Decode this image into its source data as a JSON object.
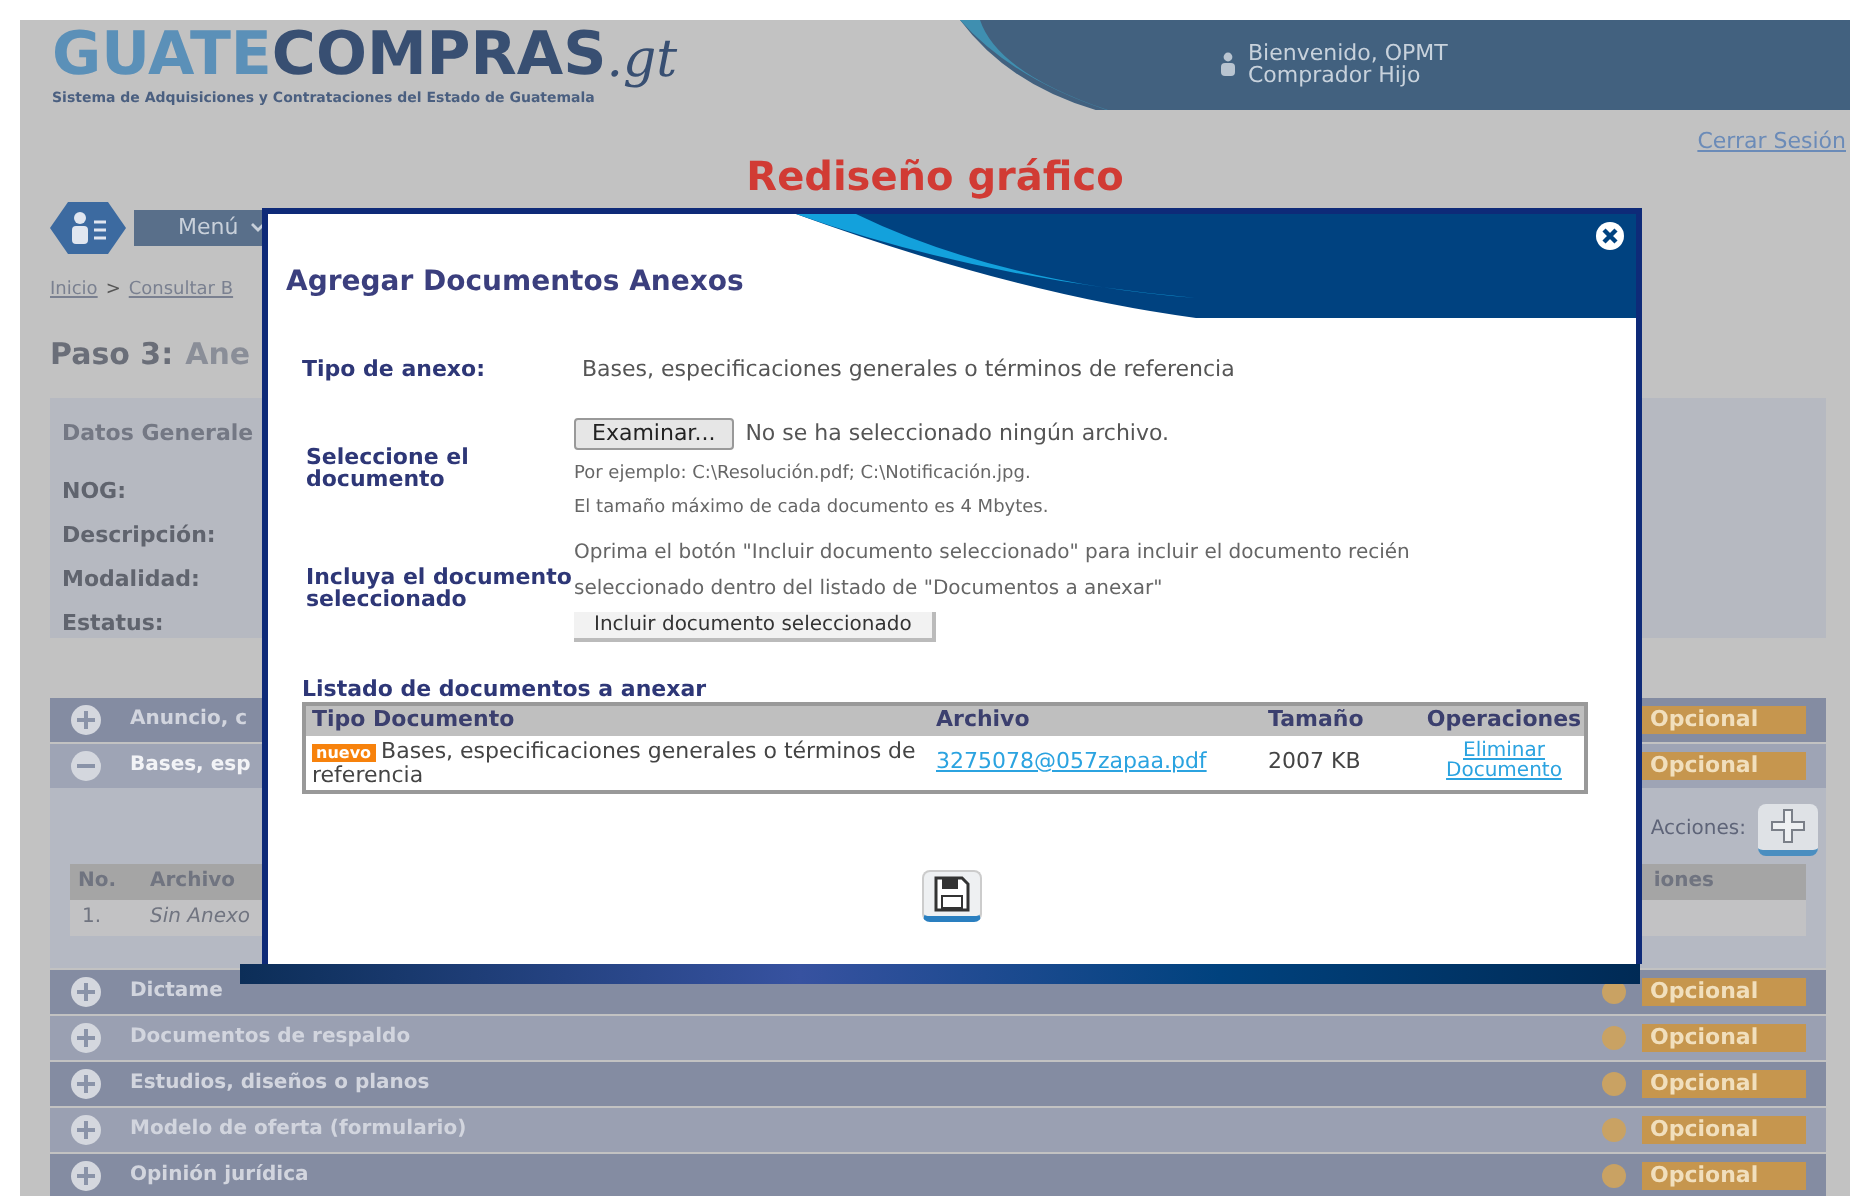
{
  "header": {
    "logo": {
      "name_light": "GUATE",
      "name_dark": "COMPRAS",
      "suffix": ".gt",
      "tagline": "Sistema de Adquisiciones y Contrataciones del Estado de Guatemala"
    },
    "user": {
      "greeting": "Bienvenido, OPMT",
      "role": "Comprador Hijo"
    }
  },
  "logout": "Cerrar Sesión",
  "page_title": "Rediseño gráfico",
  "menu": "Menú",
  "breadcrumb": [
    "Inicio",
    "Consultar B"
  ],
  "breadcrumb_separator": ">",
  "step": {
    "label": "Paso 3:",
    "text": "Ane"
  },
  "general": {
    "title": "Datos Generale",
    "fields": [
      "NOG:",
      "Descripción:",
      "Modalidad:",
      "Estatus:"
    ]
  },
  "accordion": [
    {
      "title": "Anuncio, c",
      "expanded": false,
      "badge": "Opcional"
    },
    {
      "title": "Bases, esp",
      "expanded": true,
      "badge": "Opcional",
      "panel": {
        "actions_label": "Acciones:",
        "columns": [
          "No.",
          "Archivo",
          "iones"
        ],
        "rows": [
          [
            "1.",
            "Sin Anexo"
          ]
        ]
      }
    },
    {
      "title": "Dictame",
      "expanded": false,
      "badge": "Opcional"
    },
    {
      "title": "Documentos de respaldo",
      "expanded": false,
      "badge": "Opcional"
    },
    {
      "title": "Estudios, diseños o planos",
      "expanded": false,
      "badge": "Opcional"
    },
    {
      "title": "Modelo de oferta (formulario)",
      "expanded": false,
      "badge": "Opcional"
    },
    {
      "title": "Opinión jurídica",
      "expanded": false,
      "badge": "Opcional"
    }
  ],
  "modal": {
    "title": "Agregar Documentos Anexos",
    "tipo": {
      "label": "Tipo de anexo:",
      "value": "Bases, especificaciones generales o términos de referencia"
    },
    "select": {
      "label": "Seleccione el documento",
      "browse": "Examinar...",
      "no_file": "No se ha seleccionado ningún archivo.",
      "hints": [
        "Por ejemplo: C:\\Resolución.pdf; C:\\Notificación.jpg.",
        "El tamaño máximo de cada documento es 4 Mbytes."
      ]
    },
    "include": {
      "label": "Incluya el documento seleccionado",
      "instructions": "Oprima el botón \"Incluir documento seleccionado\" para incluir el documento recién seleccionado dentro del listado de \"Documentos a anexar\"",
      "button": "Incluir documento seleccionado"
    },
    "list": {
      "title": "Listado de documentos a anexar",
      "columns": [
        "Tipo Documento",
        "Archivo",
        "Tamaño",
        "Operaciones"
      ],
      "rows": [
        {
          "badge": "nuevo",
          "tipo": "Bases, especificaciones generales o términos de referencia",
          "archivo": "3275078@057zapaa.pdf",
          "size": "2007 KB",
          "action": "Eliminar Documento"
        }
      ]
    }
  }
}
